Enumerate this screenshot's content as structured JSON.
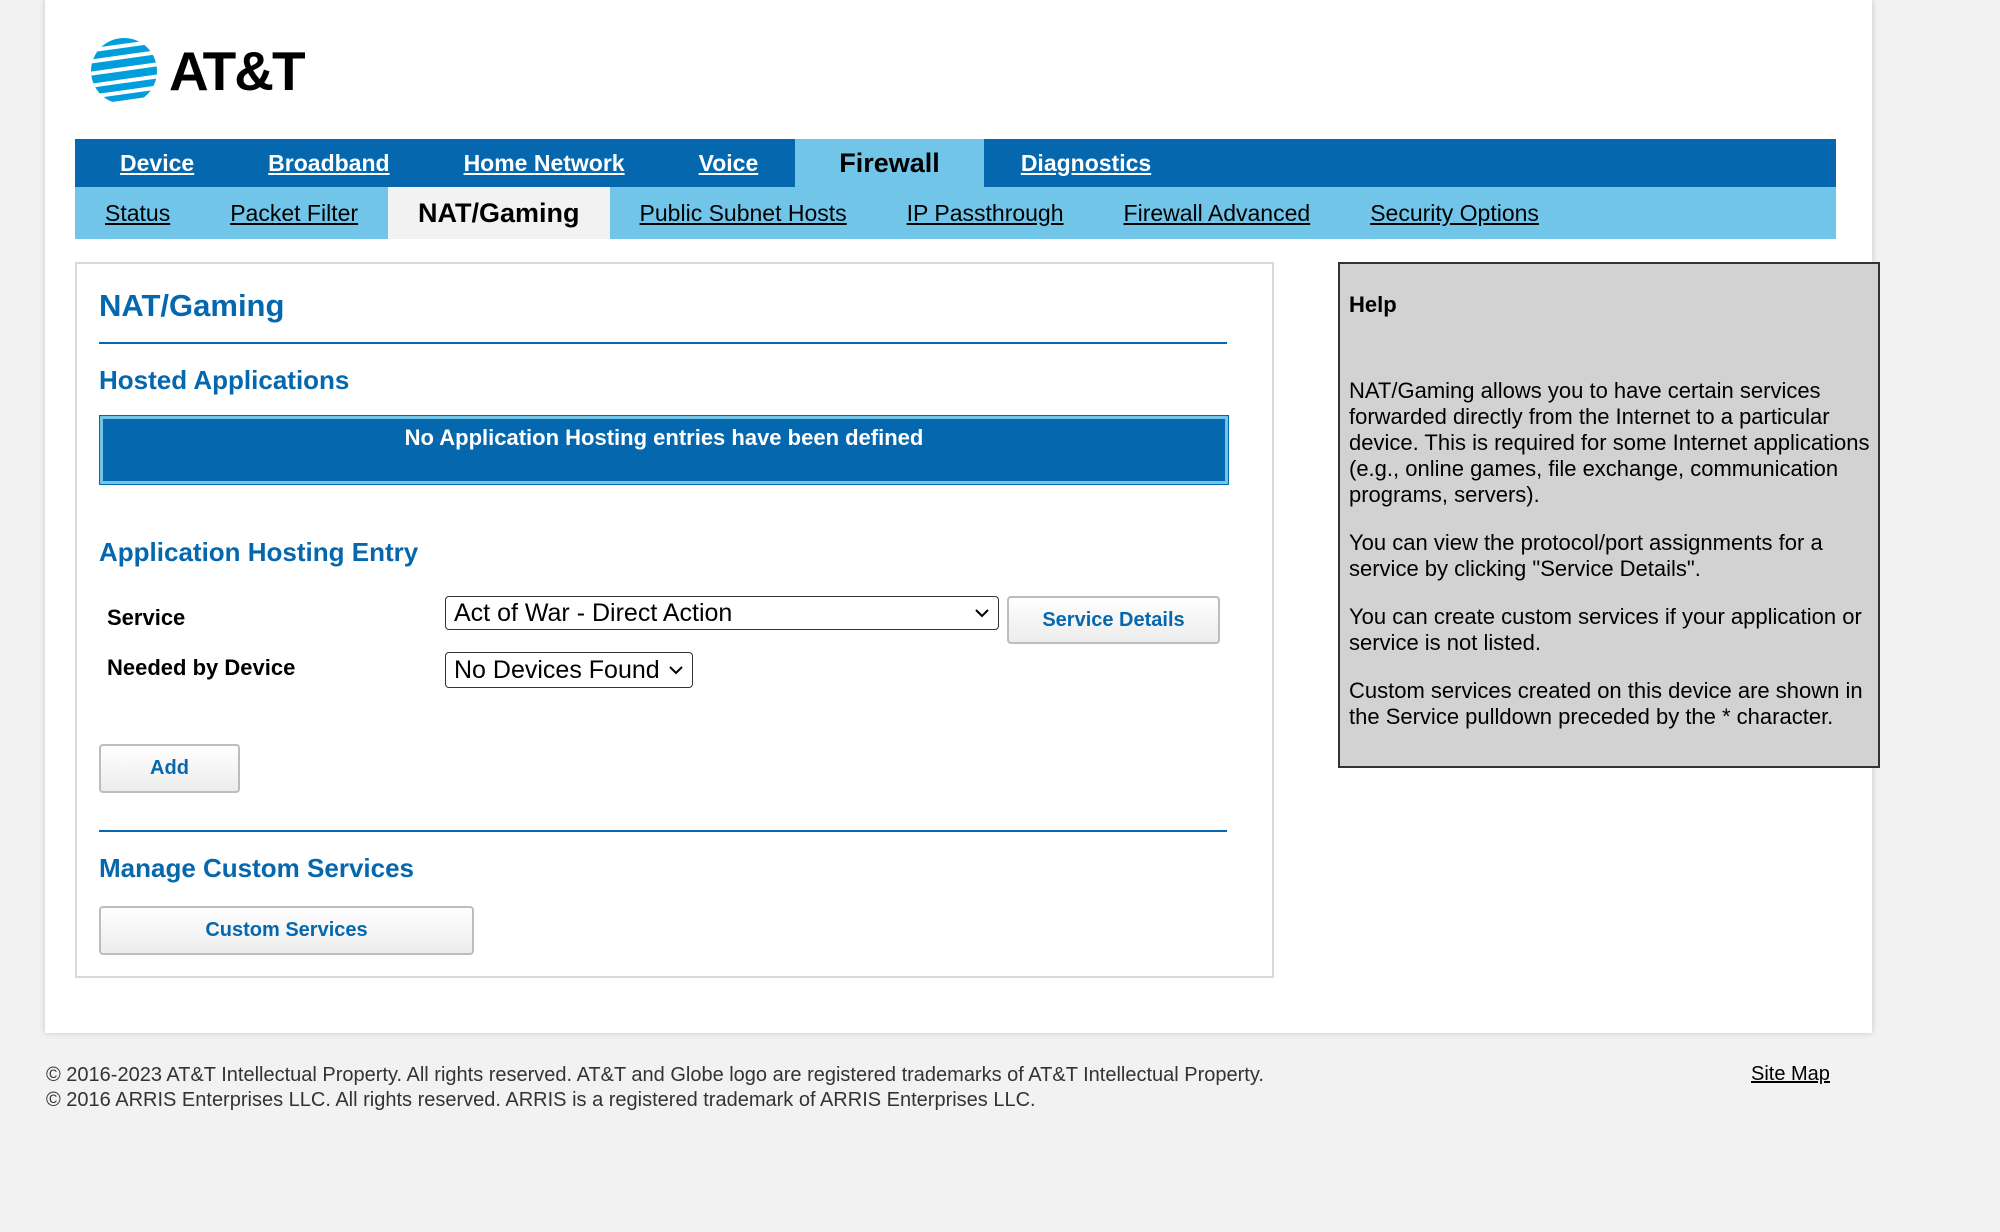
{
  "brand": {
    "name": "AT&T",
    "accent": "#0568ae",
    "light_accent": "#71c5e8"
  },
  "primary_nav": [
    {
      "label": "Device",
      "active": false
    },
    {
      "label": "Broadband",
      "active": false
    },
    {
      "label": "Home Network",
      "active": false
    },
    {
      "label": "Voice",
      "active": false
    },
    {
      "label": "Firewall",
      "active": true
    },
    {
      "label": "Diagnostics",
      "active": false
    }
  ],
  "secondary_nav": [
    {
      "label": "Status",
      "active": false
    },
    {
      "label": "Packet Filter",
      "active": false
    },
    {
      "label": "NAT/Gaming",
      "active": true
    },
    {
      "label": "Public Subnet Hosts",
      "active": false
    },
    {
      "label": "IP Passthrough",
      "active": false
    },
    {
      "label": "Firewall Advanced",
      "active": false
    },
    {
      "label": "Security Options",
      "active": false
    }
  ],
  "main": {
    "page_title": "NAT/Gaming",
    "hosted_apps_title": "Hosted Applications",
    "hosted_apps_empty": "No Application Hosting entries have been defined",
    "entry_title": "Application Hosting Entry",
    "service_label": "Service",
    "service_value": "Act of War - Direct Action",
    "service_details_button": "Service Details",
    "device_label": "Needed by Device",
    "device_value": "No Devices Found",
    "add_button": "Add",
    "manage_title": "Manage Custom Services",
    "custom_services_button": "Custom Services"
  },
  "help": {
    "title": "Help",
    "paragraphs": [
      "NAT/Gaming allows you to have certain services forwarded directly from the Internet to a particular device. This is required for some Internet applications (e.g., online games, file exchange, communication programs, servers).",
      "You can view the protocol/port assignments for a service by clicking \"Service Details\".",
      "You can create custom services if your application or service is not listed.",
      "Custom services created on this device are shown in the Service pulldown preceded by the * character."
    ]
  },
  "footer": {
    "line1": "© 2016-2023 AT&T Intellectual Property. All rights reserved. AT&T and Globe logo are registered trademarks of AT&T Intellectual Property.",
    "line2": "© 2016 ARRIS Enterprises LLC. All rights reserved. ARRIS is a registered trademark of ARRIS Enterprises LLC.",
    "site_map": "Site Map"
  }
}
